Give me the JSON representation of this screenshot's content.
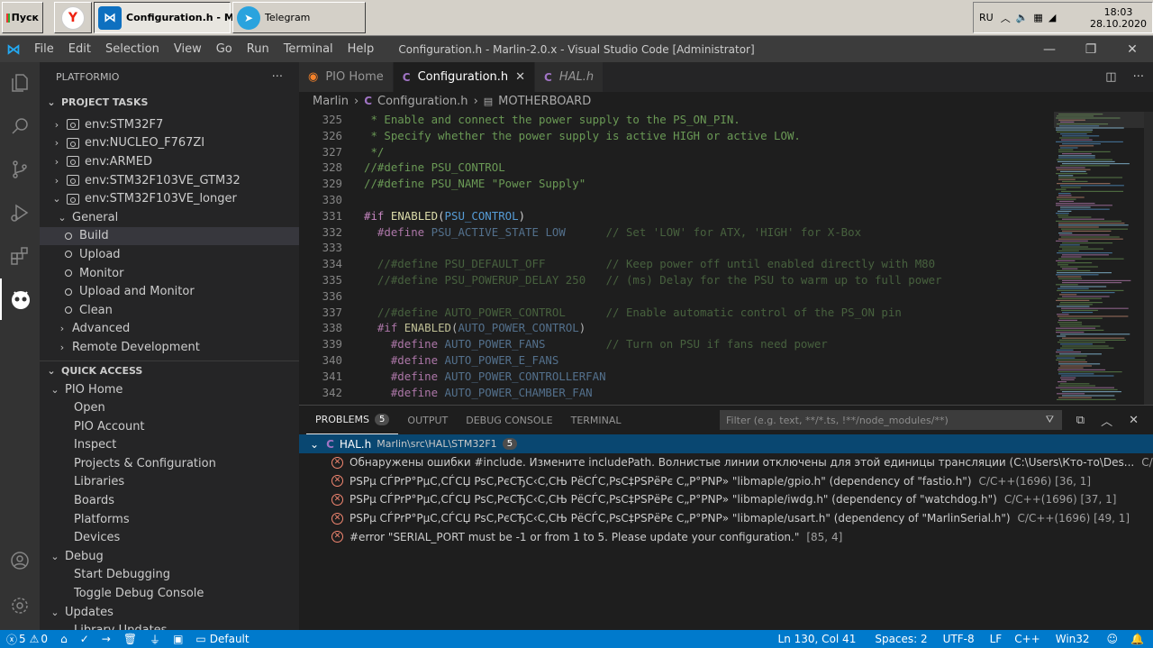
{
  "taskbar": {
    "start_label": "Пуск",
    "items": [
      {
        "label": "",
        "icon": "yandex-browser-icon"
      },
      {
        "label": "Configuration.h - M...",
        "icon": "vscode-icon"
      },
      {
        "label": "Telegram",
        "icon": "telegram-icon"
      }
    ],
    "tray": {
      "lang": "RU",
      "time": "18:03",
      "date": "28.10.2020"
    }
  },
  "titlebar": {
    "menu": [
      "File",
      "Edit",
      "Selection",
      "View",
      "Go",
      "Run",
      "Terminal",
      "Help"
    ],
    "title": "Configuration.h - Marlin-2.0.x - Visual Studio Code [Administrator]"
  },
  "sidebar": {
    "header": "PLATFORMIO",
    "more": "···",
    "project_tasks": {
      "title": "PROJECT TASKS",
      "envs": [
        "env:STM32F7",
        "env:NUCLEO_F767ZI",
        "env:ARMED",
        "env:STM32F103VE_GTM32",
        "env:STM32F103VE_longer"
      ],
      "general_label": "General",
      "tasks": [
        "Build",
        "Upload",
        "Monitor",
        "Upload and Monitor",
        "Clean"
      ],
      "advanced_label": "Advanced",
      "remote_label": "Remote Development"
    },
    "quick_access": {
      "title": "QUICK ACCESS",
      "pio_home_label": "PIO Home",
      "pio_home_items": [
        "Open",
        "PIO Account",
        "Inspect",
        "Projects & Configuration",
        "Libraries",
        "Boards",
        "Platforms",
        "Devices"
      ],
      "debug_label": "Debug",
      "debug_items": [
        "Start Debugging",
        "Toggle Debug Console"
      ],
      "updates_label": "Updates",
      "updates_items": [
        "Library Updates"
      ]
    }
  },
  "tabs": [
    {
      "label": "PIO Home",
      "icon": "platformio-icon",
      "active": false
    },
    {
      "label": "Configuration.h",
      "icon": "c-file-icon",
      "active": true
    },
    {
      "label": "HAL.h",
      "icon": "c-file-icon",
      "active": false
    }
  ],
  "breadcrumb": [
    "Marlin",
    "Configuration.h",
    "MOTHERBOARD"
  ],
  "code_lines": [
    {
      "n": "325",
      "text": " * Enable and connect the power supply to the PS_ON_PIN."
    },
    {
      "n": "326",
      "text": " * Specify whether the power supply is active HIGH or active LOW."
    },
    {
      "n": "327",
      "text": " */"
    },
    {
      "n": "328",
      "text": "//#define PSU_CONTROL"
    },
    {
      "n": "329",
      "text": "//#define PSU_NAME \"Power Supply\""
    },
    {
      "n": "330",
      "text": ""
    },
    {
      "n": "331",
      "text": "#if ENABLED(PSU_CONTROL)"
    },
    {
      "n": "332",
      "text": "  #define PSU_ACTIVE_STATE LOW      // Set 'LOW' for ATX, 'HIGH' for X-Box"
    },
    {
      "n": "333",
      "text": ""
    },
    {
      "n": "334",
      "text": "  //#define PSU_DEFAULT_OFF         // Keep power off until enabled directly with M80"
    },
    {
      "n": "335",
      "text": "  //#define PSU_POWERUP_DELAY 250   // (ms) Delay for the PSU to warm up to full power"
    },
    {
      "n": "336",
      "text": ""
    },
    {
      "n": "337",
      "text": "  //#define AUTO_POWER_CONTROL      // Enable automatic control of the PS_ON pin"
    },
    {
      "n": "338",
      "text": "  #if ENABLED(AUTO_POWER_CONTROL)"
    },
    {
      "n": "339",
      "text": "    #define AUTO_POWER_FANS         // Turn on PSU if fans need power"
    },
    {
      "n": "340",
      "text": "    #define AUTO_POWER_E_FANS"
    },
    {
      "n": "341",
      "text": "    #define AUTO_POWER_CONTROLLERFAN"
    },
    {
      "n": "342",
      "text": "    #define AUTO_POWER_CHAMBER_FAN"
    }
  ],
  "panel": {
    "tabs": [
      "PROBLEMS",
      "OUTPUT",
      "DEBUG CONSOLE",
      "TERMINAL"
    ],
    "problems_count": "5",
    "filter_placeholder": "Filter (e.g. text, **/*.ts, !**/node_modules/**)",
    "file": {
      "name": "HAL.h",
      "path": "Marlin\\src\\HAL\\STM32F1",
      "count": "5"
    },
    "problems": [
      {
        "msg": "Обнаружены ошибки #include. Измените includePath. Волнистые линии отключены для этой единицы трансляции (C:\\Users\\Кто-то\\Des...",
        "meta": "C/C++(1696) [36, 1]"
      },
      {
        "msg": "PSPµ CЃPrP°PµC‚CЃCЏ PsC‚PєCЂC‹C‚CЊ PёCЃC‚PsC‡PSPёPє C„P°PNP» \"libmaple/gpio.h\" (dependency of \"fastio.h\")",
        "meta": "C/C++(1696) [36, 1]"
      },
      {
        "msg": "PSPµ CЃPrP°PµC‚CЃCЏ PsC‚PєCЂC‹C‚CЊ PёCЃC‚PsC‡PSPёPє C„P°PNP» \"libmaple/iwdg.h\" (dependency of \"watchdog.h\")",
        "meta": "C/C++(1696) [37, 1]"
      },
      {
        "msg": "PSPµ CЃPrP°PµC‚CЃCЏ PsC‚PєCЂC‹C‚CЊ PёCЃC‚PsC‡PSPёPє C„P°PNP» \"libmaple/usart.h\" (dependency of \"MarlinSerial.h\")",
        "meta": "C/C++(1696) [49, 1]"
      },
      {
        "msg": "#error \"SERIAL_PORT must be -1 or from 1 to 5. Please update your configuration.\"",
        "meta": "[85, 4]"
      }
    ]
  },
  "statusbar": {
    "errors": "5",
    "warnings": "0",
    "env": "Default",
    "position": "Ln 130, Col 41",
    "spaces": "Spaces: 2",
    "encoding": "UTF-8",
    "eol": "LF",
    "language": "C++",
    "platform": "Win32"
  }
}
